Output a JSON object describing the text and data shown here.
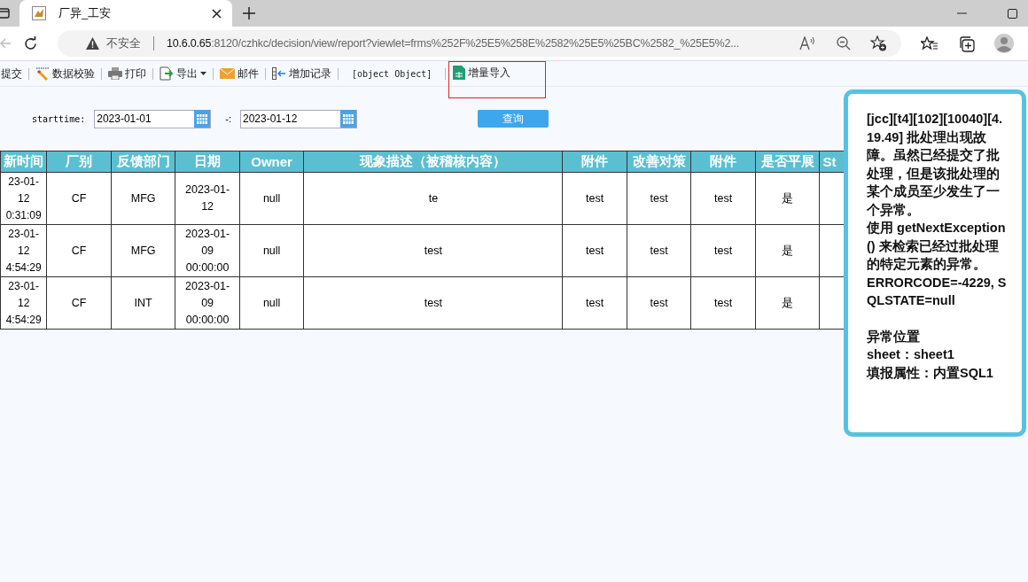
{
  "browser": {
    "tab_title": "厂异_工安",
    "security": "不安全",
    "url_host": "10.6.0.65",
    "url_rest": ":8120/czhkc/decision/view/report?viewlet=frms%252F%25E5%258E%2582%25E5%25BC%2582_%25E5%2..."
  },
  "toolbar": [
    {
      "kind": "plain",
      "label": "提交",
      "highlighted": false
    },
    {
      "kind": "check",
      "label": "数据校验",
      "highlighted": false
    },
    {
      "kind": "print",
      "label": "打印",
      "highlighted": false
    },
    {
      "kind": "export",
      "label": "导出",
      "highlighted": false
    },
    {
      "kind": "mail",
      "label": "邮件",
      "highlighted": false
    },
    {
      "kind": "add",
      "label": "增加记录",
      "highlighted": false
    },
    {
      "kind": "mono",
      "label": "[object Object]",
      "highlighted": false
    },
    {
      "kind": "sheet",
      "label": "增量导入",
      "highlighted": true
    }
  ],
  "filter": {
    "label": "starttime:",
    "start": "2023-01-01",
    "separator": "-:",
    "end": "2023-01-12",
    "query": "查询"
  },
  "table": {
    "columns": [
      "新时间",
      "厂别",
      "反馈部门",
      "日期",
      "Owner",
      "现象描述（被稽核内容）",
      "附件",
      "改善对策",
      "附件",
      "是否平展",
      "St"
    ],
    "rows": [
      [
        "23-01-12 0:31:09",
        "CF",
        "MFG",
        "2023-01-12",
        "null",
        "te",
        "test",
        "test",
        "test",
        "是"
      ],
      [
        "23-01-12 4:54:29",
        "CF",
        "MFG",
        "2023-01-09 00:00:00",
        "null",
        "test",
        "test",
        "test",
        "test",
        "是"
      ],
      [
        "23-01-12 4:54:29",
        "CF",
        "INT",
        "2023-01-09 00:00:00",
        "null",
        "test",
        "test",
        "test",
        "test",
        "是"
      ]
    ]
  },
  "error_tooltip": {
    "message": "[jcc][t4][102][10040][4.19.49] 批处理出现故障。虽然已经提交了批处理，但是该批处理的某个成员至少发生了一个异常。",
    "hint": "使用 getNextException() 来检索已经过批处理的特定元素的异常。",
    "codes": "ERRORCODE=-4229, SQLSTATE=null",
    "location_title": "异常位置",
    "location_lines": [
      "sheet：sheet1",
      "填报属性：内置SQL1"
    ]
  }
}
